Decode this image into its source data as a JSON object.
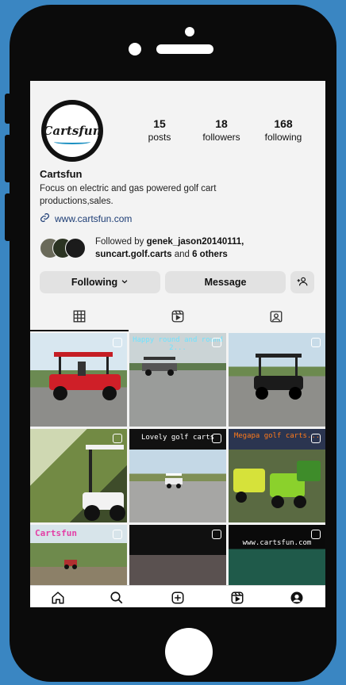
{
  "profile": {
    "logo_text": "Cartsfun",
    "name": "Cartsfun",
    "bio": "Focus on electric and gas powered golf cart productions,sales.",
    "website": "www.cartsfun.com"
  },
  "stats": [
    {
      "num": "15",
      "label": "posts"
    },
    {
      "num": "18",
      "label": "followers"
    },
    {
      "num": "168",
      "label": "following"
    }
  ],
  "followed_by": {
    "prefix": "Followed by ",
    "users": "genek_jason20140111,",
    "users2": "suncart.golf.carts",
    "and_text": " and ",
    "others": "6 others"
  },
  "buttons": {
    "following": "Following",
    "message": "Message"
  },
  "grid_captions": {
    "c2": "Happy round and round 2...",
    "c5": "Lovely golf carts",
    "c6": "Megapa golf carts...",
    "c7": "Cartsfun",
    "c9": "www.cartsfun.com"
  },
  "icons": {
    "link": "link-icon",
    "dropdown": "chevron-down-icon",
    "add_user": "add-user-icon",
    "grid_tab": "grid-icon",
    "reels_tab": "reels-icon",
    "tagged_tab": "tagged-icon",
    "nav": [
      "home-icon",
      "search-icon",
      "create-icon",
      "reels-icon",
      "profile-icon"
    ]
  },
  "colors": {
    "background": "#3a86c2",
    "phone": "#0b0b0b",
    "screen": "#f3f3f3",
    "link": "#1d3d75"
  }
}
